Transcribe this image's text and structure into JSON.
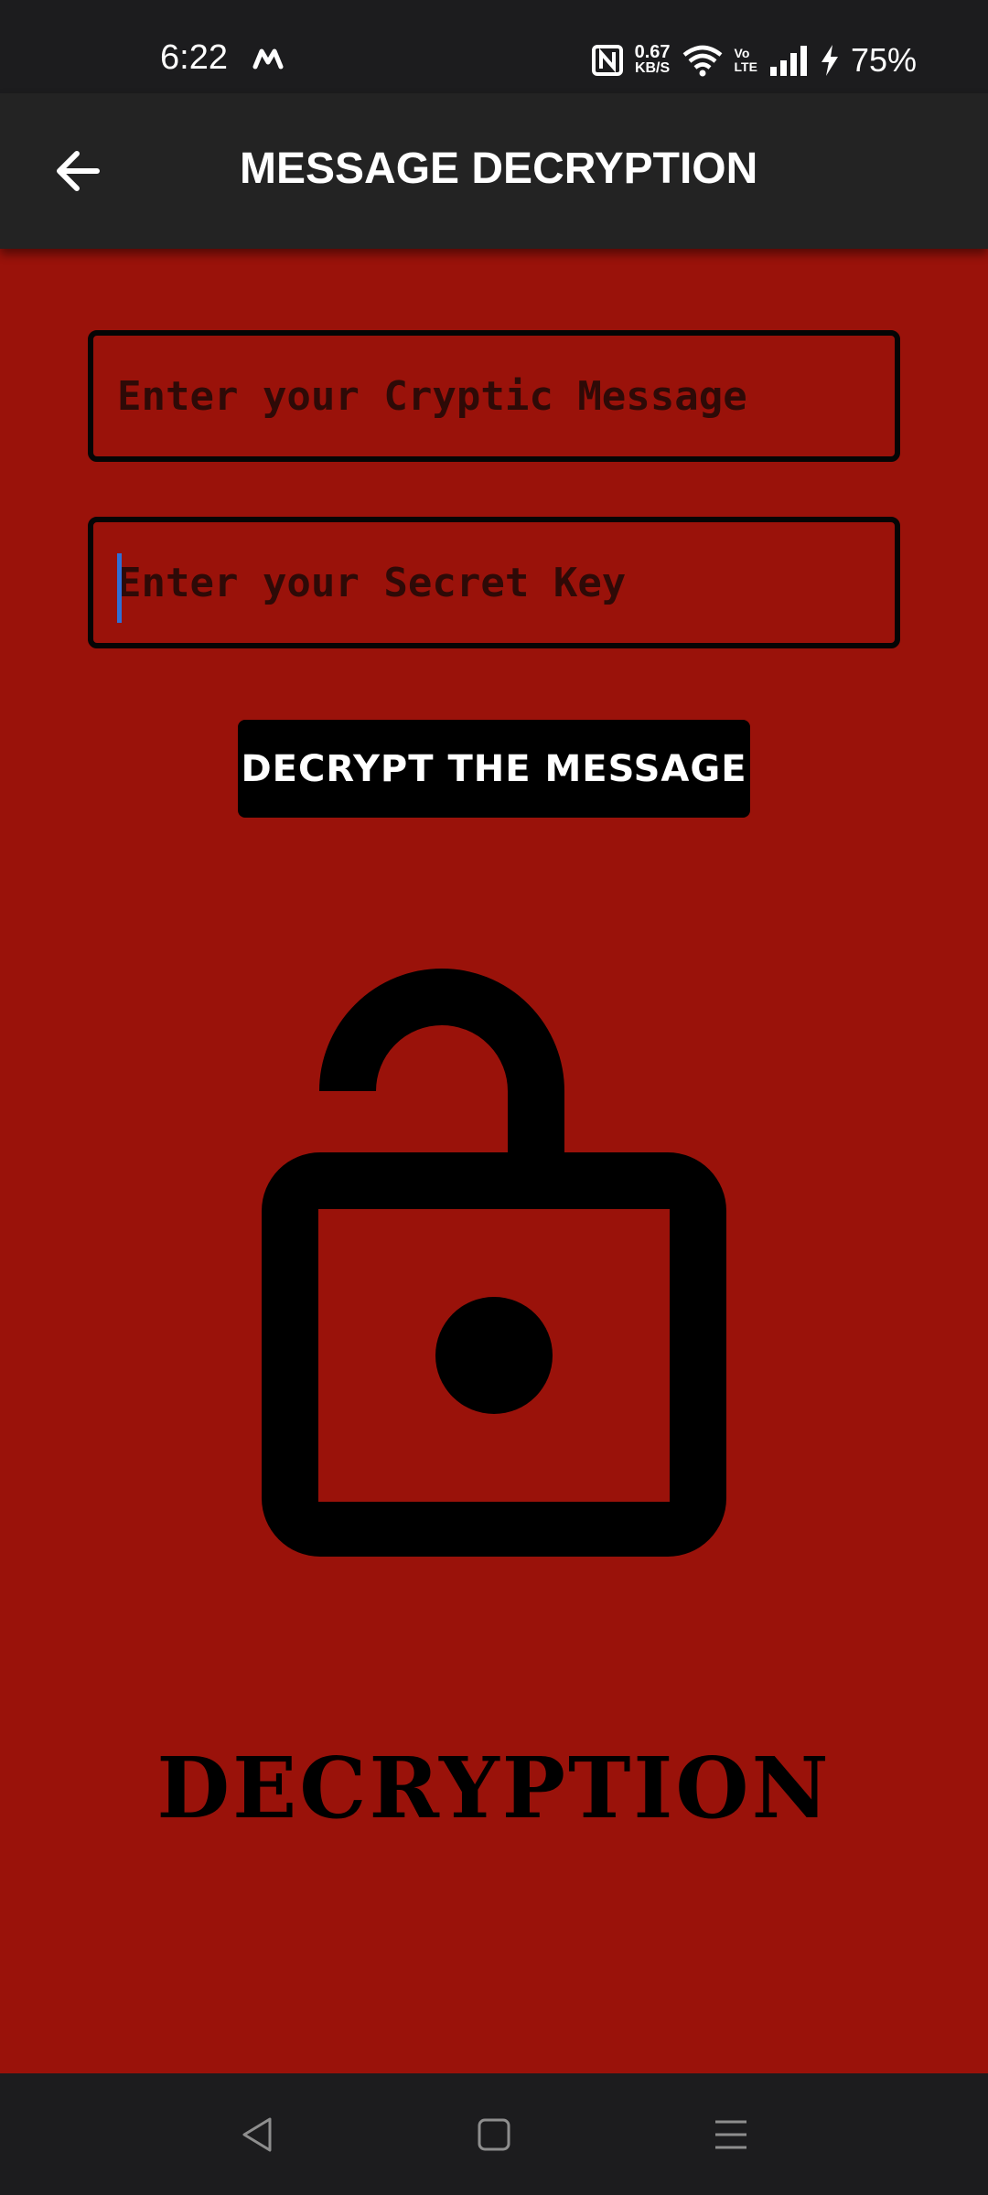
{
  "status_bar": {
    "time": "6:22",
    "network_speed_value": "0.67",
    "network_speed_unit": "KB/S",
    "volte_top": "Vo",
    "volte_bottom": "LTE",
    "battery": "75%",
    "icons": [
      "m-app-icon",
      "nfc-icon",
      "wifi-icon",
      "signal-icon",
      "charging-icon"
    ]
  },
  "app_bar": {
    "title": "MESSAGE DECRYPTION",
    "back_icon": "arrow-left-icon"
  },
  "form": {
    "message_placeholder": "Enter your Cryptic Message",
    "message_value": "",
    "key_placeholder": "Enter your Secret Key",
    "key_value": "",
    "decrypt_button_label": "DECRYPT THE MESSAGE"
  },
  "illustration": {
    "icon": "unlocked-padlock-icon"
  },
  "footer_label": "DECRYPTION",
  "nav_bar": {
    "icons": [
      "nav-back-icon",
      "nav-home-icon",
      "nav-recents-icon"
    ]
  },
  "colors": {
    "background": "#9a120a",
    "app_bar": "#232323",
    "system_bars": "#1c1c1e",
    "button": "#000000",
    "caret": "#2f6fd6"
  }
}
